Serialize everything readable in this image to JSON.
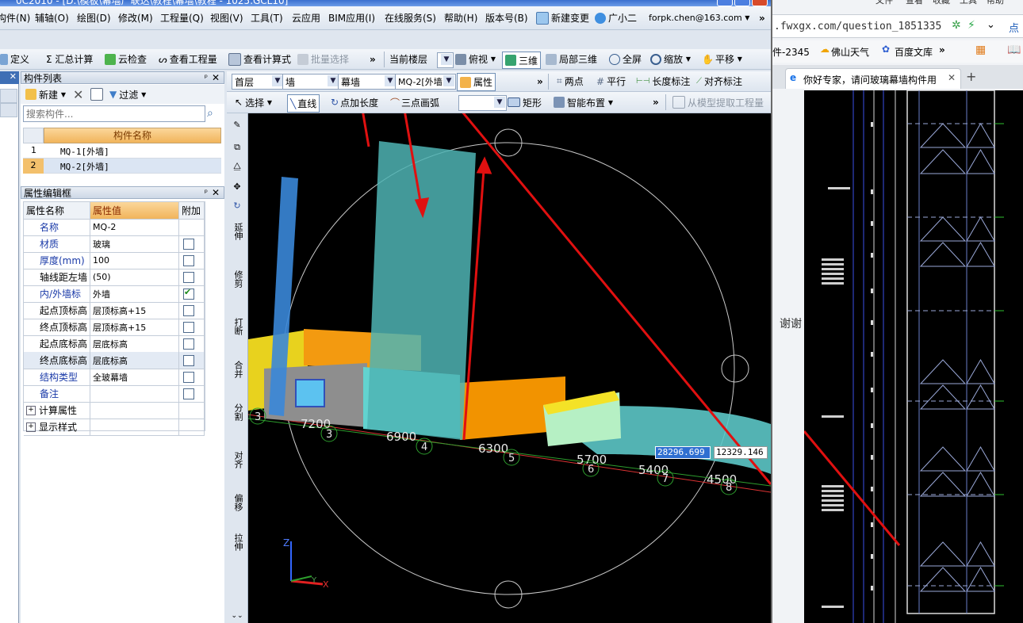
{
  "title_bar": {
    "text": "0C2010 - [D:\\模板\\幕墙广联达\\教程\\幕墙\\教程 - 1025.GCL10]"
  },
  "menu": [
    {
      "label": "构件(N)"
    },
    {
      "label": "辅轴(O)"
    },
    {
      "label": "绘图(D)"
    },
    {
      "label": "修改(M)"
    },
    {
      "label": "工程量(Q)"
    },
    {
      "label": "视图(V)"
    },
    {
      "label": "工具(T)"
    },
    {
      "label": "云应用"
    },
    {
      "label": "BIM应用(I)"
    },
    {
      "label": "在线服务(S)"
    },
    {
      "label": "帮助(H)"
    },
    {
      "label": "版本号(B)"
    }
  ],
  "menu_right": {
    "new_change": "新建变更",
    "guang_xiao_er": "广小二",
    "account": "forpk.chen@163.com",
    "more": "»"
  },
  "toolbar1": {
    "define": "定义",
    "summary": "Σ 汇总计算",
    "cloud_check": "云检查",
    "view_quantity": "查看工程量",
    "view_formula": "查看计算式",
    "batch_select": "批量选择",
    "more": "»",
    "current_floor": "当前楼层",
    "top_view": "俯视",
    "three_d": "三维",
    "partial_3d": "局部三维",
    "fullscreen": "全屏",
    "zoom": "缩放",
    "pan": "平移"
  },
  "component_list": {
    "header": "构件列表",
    "pin": "ᴾ",
    "close": "✕",
    "new_label": "新建",
    "filter_label": "过滤",
    "search_placeholder": "搜索构件...",
    "column_header": "构件名称",
    "rows": [
      {
        "index": "1",
        "name": "MQ-1[外墙]"
      },
      {
        "index": "2",
        "name": "MQ-2[外墙]"
      }
    ]
  },
  "properties": {
    "header": "属性编辑框",
    "col_name": "属性名称",
    "col_value": "属性值",
    "col_extra": "附加",
    "rows": [
      {
        "name": "名称",
        "value": "MQ-2",
        "check": "none",
        "blue": true
      },
      {
        "name": "材质",
        "value": "玻璃",
        "check": "off",
        "blue": true
      },
      {
        "name": "厚度(mm)",
        "value": "100",
        "check": "off",
        "blue": true
      },
      {
        "name": "轴线距左墙",
        "value": "(50)",
        "check": "off",
        "blue": false
      },
      {
        "name": "内/外墙标",
        "value": "外墙",
        "check": "on",
        "blue": true
      },
      {
        "name": "起点顶标高",
        "value": "层顶标高+15",
        "check": "off",
        "blue": false
      },
      {
        "name": "终点顶标高",
        "value": "层顶标高+15",
        "check": "off",
        "blue": false
      },
      {
        "name": "起点底标高",
        "value": "层底标高",
        "check": "off",
        "blue": false
      },
      {
        "name": "终点底标高",
        "value": "层底标高",
        "check": "off",
        "blue": false
      },
      {
        "name": "结构类型",
        "value": "全玻幕墙",
        "check": "off",
        "blue": true
      },
      {
        "name": "备注",
        "value": "",
        "check": "off",
        "blue": true
      },
      {
        "name": "计算属性",
        "value": "",
        "check": "none",
        "blue": false,
        "expand": "+"
      },
      {
        "name": "显示样式",
        "value": "",
        "check": "none",
        "blue": false,
        "expand": "+"
      }
    ]
  },
  "toolbar2": {
    "floor": "首层",
    "category": "墙",
    "type": "幕墙",
    "component": "MQ-2[外墙",
    "properties": "属性",
    "more": "»",
    "two_point": "两点",
    "parallel": "平行",
    "length_dim": "长度标注",
    "align_dim": "对齐标注"
  },
  "toolbar3": {
    "select": "选择",
    "line": "直线",
    "point_length": "点加长度",
    "arc3": "三点画弧",
    "rect": "矩形",
    "smart_place": "智能布置",
    "more": "»",
    "extract": "从模型提取工程量"
  },
  "vertical_tools": [
    {
      "label": "延伸"
    },
    {
      "label": "修剪"
    },
    {
      "label": "打断"
    },
    {
      "label": "合并"
    },
    {
      "label": "分割"
    },
    {
      "label": "对齐"
    },
    {
      "label": "偏移"
    },
    {
      "label": "拉伸"
    }
  ],
  "viewport": {
    "dims": [
      "7200",
      "6900",
      "6300",
      "5700",
      "5400",
      "4500"
    ],
    "axes": [
      "3",
      "4",
      "5",
      "6",
      "7",
      "8",
      "3"
    ],
    "coord_x": "28296.699",
    "coord_y": "12329.146",
    "axis_x": "X",
    "axis_z": "Z",
    "axis_y": "Y"
  },
  "browser": {
    "menu": [
      "文件",
      "查看",
      "收藏",
      "工具",
      "帮助"
    ],
    "url": ".fwxgx.com/question_1851335",
    "bookmarks": {
      "software": "件-2345",
      "weather": "佛山天气",
      "library": "百度文库",
      "more": "»"
    },
    "tab_title": "你好专家，请问玻璃幕墙构件用",
    "side_text": "谢谢",
    "more_dots": "点",
    "new_tab": "+"
  },
  "colors": {
    "accent": "#2f6fd1",
    "cyan_glass": "#5cc7c7",
    "orange": "#f39a10",
    "yellow": "#f4e227",
    "red_arrow": "#e01010"
  }
}
